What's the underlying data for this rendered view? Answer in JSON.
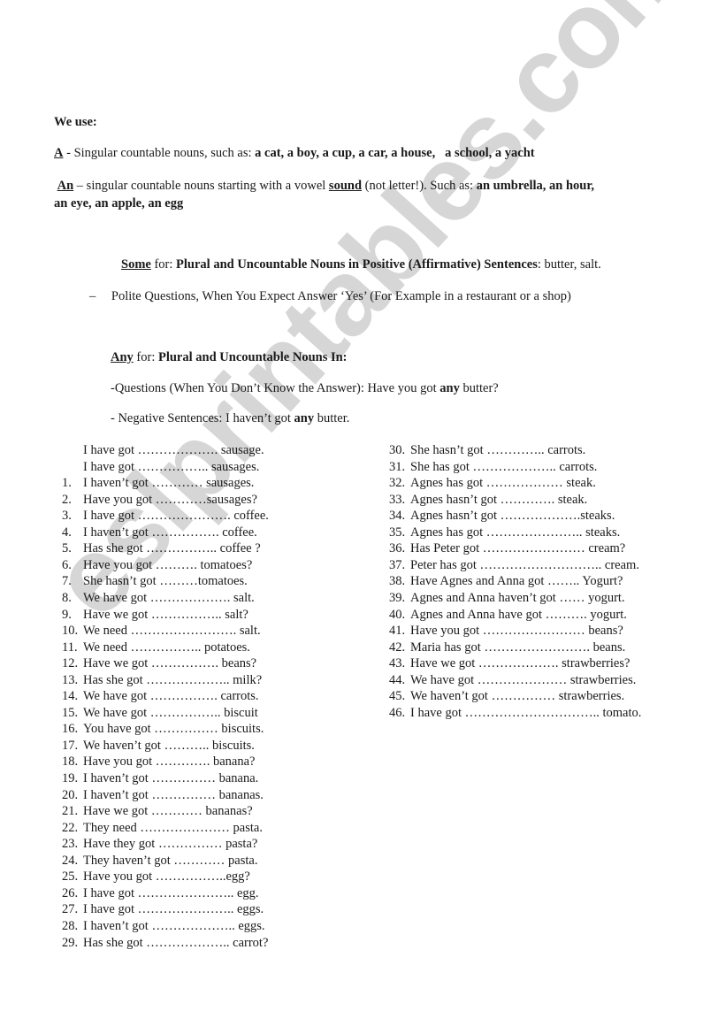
{
  "watermark": "eslprintables.com",
  "intro": {
    "heading": "We use:",
    "a_rule": {
      "label": "A",
      "text": " - Singular countable nouns, such as: ",
      "examples": "a cat, a boy, a cup, a car, a house,   a school, a yacht"
    },
    "an_rule": {
      "label": "An",
      "text1": " – singular countable nouns starting with a vowel ",
      "emphasis": "sound",
      "text2": " (not letter!). Such as: ",
      "examples_line1": "an umbrella, an hour,",
      "examples_line2": "an eye, an apple, an egg"
    }
  },
  "some_rule": {
    "label": "Some",
    "for": " for: ",
    "bold": "Plural and Uncountable Nouns in Positive (Affirmative) Sentences",
    "tail": ": butter, salt.",
    "dash": "–",
    "polite": "Polite Questions, When You Expect Answer ‘Yes’ (For Example in a restaurant or a shop)"
  },
  "any_rule": {
    "label": "Any",
    "for": " for: ",
    "bold": "Plural and Uncountable Nouns In:",
    "questions_pre": " -Questions (When You Don’t Know the Answer): Have you got ",
    "questions_any": "any",
    "questions_post": " butter?",
    "negative_pre": "- Negative Sentences: I haven’t got ",
    "negative_any": "any",
    "negative_post": " butter."
  },
  "examples_left": [
    {
      "num": "",
      "text": "I have got ………………. sausage."
    },
    {
      "num": "",
      "text": "I have got …………….. sausages."
    },
    {
      "num": "1.",
      "text": "I haven’t got ………… sausages."
    },
    {
      "num": "2.",
      "text": "Have you got …………sausages?"
    },
    {
      "num": "3.",
      "text": "I have got …………………. coffee."
    },
    {
      "num": "4.",
      "text": "I haven’t got ……………. coffee."
    },
    {
      "num": "5.",
      "text": "Has she got …………….. coffee ?"
    },
    {
      "num": "6.",
      "text": "Have you got ………. tomatoes?"
    },
    {
      "num": "7.",
      "text": "She hasn’t got ………tomatoes."
    },
    {
      "num": "8.",
      "text": "We have got ………………. salt."
    },
    {
      "num": "9.",
      "text": "Have we got …………….. salt?"
    },
    {
      "num": "10.",
      "text": "We need ……………………. salt."
    },
    {
      "num": "11.",
      "text": "We need …………….. potatoes."
    },
    {
      "num": "12.",
      "text": "Have we got ……………. beans?"
    },
    {
      "num": "13.",
      "text": "Has she got ……………….. milk?"
    },
    {
      "num": "14.",
      "text": "We have got ……………. carrots."
    },
    {
      "num": "15.",
      "text": "We have got …………….. biscuit"
    },
    {
      "num": "16.",
      "text": "You have got …………… biscuits."
    },
    {
      "num": "17.",
      "text": "We haven’t got ……….. biscuits."
    },
    {
      "num": "18.",
      "text": "Have you got …………. banana?"
    },
    {
      "num": "19.",
      "text": "I haven’t got …………… banana."
    },
    {
      "num": "20.",
      "text": "I haven’t got …………… bananas."
    },
    {
      "num": "21.",
      "text": "Have we got ………… bananas?"
    },
    {
      "num": "22.",
      "text": "They need ………………… pasta."
    },
    {
      "num": "23.",
      "text": "Have they got …………… pasta?"
    },
    {
      "num": "24.",
      "text": "They haven’t got ………… pasta."
    },
    {
      "num": "25.",
      "text": "Have you got ……………..egg?"
    },
    {
      "num": "26.",
      "text": "I have got ………………….. egg."
    },
    {
      "num": "27.",
      "text": "I have got ………………….. eggs."
    },
    {
      "num": "28.",
      "text": "I haven’t got ……………….. eggs."
    },
    {
      "num": "29.",
      "text": "Has she got ……………….. carrot?"
    }
  ],
  "examples_right": [
    {
      "num": "30.",
      "text": "She hasn’t got ………….. carrots."
    },
    {
      "num": "31.",
      "text": "She has got ……………….. carrots."
    },
    {
      "num": "32.",
      "text": "Agnes has got ……………… steak."
    },
    {
      "num": "33.",
      "text": "Agnes hasn’t got …………. steak."
    },
    {
      "num": "34.",
      "text": "Agnes hasn’t got ……………….steaks."
    },
    {
      "num": "35.",
      "text": "Agnes has got ………………….. steaks."
    },
    {
      "num": "36.",
      "text": "Has Peter got …………………… cream?"
    },
    {
      "num": "37.",
      "text": "Peter has got ……………………….. cream."
    },
    {
      "num": "38.",
      "text": "Have Agnes and Anna got …….. Yogurt?"
    },
    {
      "num": "39.",
      "text": "Agnes and Anna haven’t got …… yogurt."
    },
    {
      "num": "40.",
      "text": "Agnes and Anna have got ………. yogurt."
    },
    {
      "num": "41.",
      "text": "Have you got …………………… beans?"
    },
    {
      "num": "42.",
      "text": "Maria has got ……………………. beans."
    },
    {
      "num": "43.",
      "text": "Have we got ………………. strawberries?"
    },
    {
      "num": "44.",
      "text": "We have got ………………… strawberries."
    },
    {
      "num": "45.",
      "text": "We haven’t got …………… strawberries."
    },
    {
      "num": "46.",
      "text": "I have got ………………………….. tomato."
    }
  ]
}
